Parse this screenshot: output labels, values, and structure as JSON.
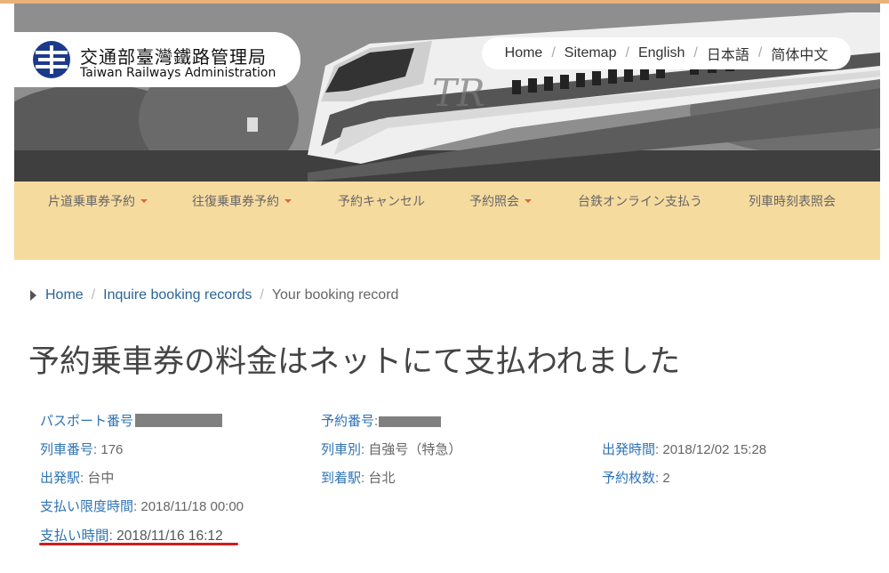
{
  "header": {
    "logo_zh": "交通部臺灣鐵路管理局",
    "logo_en": "Taiwan Railways Administration",
    "top_links": [
      "Home",
      "Sitemap",
      "English",
      "日本語",
      "简体中文"
    ]
  },
  "nav": {
    "items": [
      {
        "label": "片道乗車券予約",
        "dropdown": true
      },
      {
        "label": "往復乗車券予約",
        "dropdown": true
      },
      {
        "label": "予約キャンセル",
        "dropdown": false
      },
      {
        "label": "予約照会",
        "dropdown": true
      },
      {
        "label": "台鉄オンライン支払う",
        "dropdown": false
      },
      {
        "label": "列車時刻表照会",
        "dropdown": false
      }
    ]
  },
  "breadcrumb": {
    "home": "Home",
    "inquire": "Inquire booking records",
    "current": "Your booking record"
  },
  "page_title": "予約乗車券の料金はネットにて支払われました",
  "booking": {
    "passport_label": "パスポート番号",
    "booking_no_label": "予約番号",
    "booking_no_visible": ":",
    "train_no_label": "列車番号",
    "train_no": "176",
    "train_type_label": "列車別",
    "train_type": "自強号（特急）",
    "departure_time_label": "出発時間",
    "departure_time": "2018/12/02 15:28",
    "origin_label": "出発駅",
    "origin": "台中",
    "destination_label": "到着駅",
    "destination": "台北",
    "tickets_label": "予約枚数",
    "tickets": "2",
    "deadline_label": "支払い限度時間",
    "deadline": "2018/11/18 00:00",
    "paid_time_label": "支払い時間",
    "paid_time": "2018/11/16 16:12"
  },
  "colors": {
    "nav_bg": "#f6db9f",
    "link": "#2f73b4",
    "accent_underline": "#d21c1c",
    "caret": "#d9663b"
  }
}
